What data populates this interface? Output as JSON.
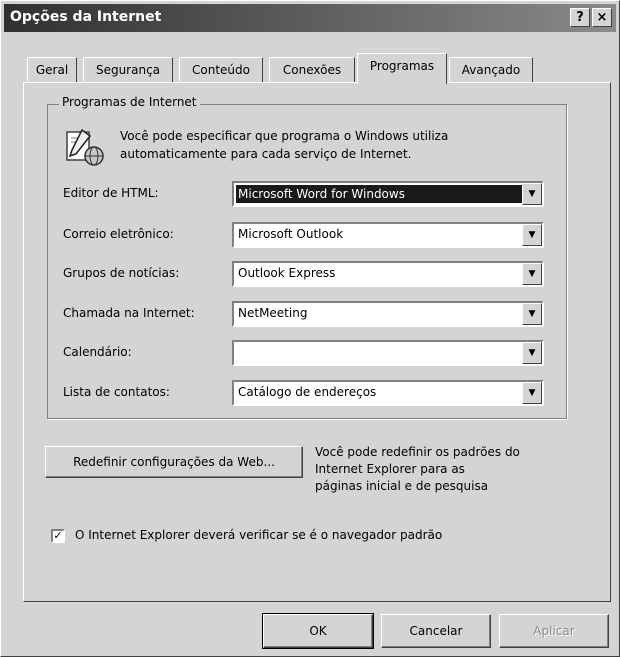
{
  "window": {
    "title": "Opções da Internet",
    "help_button": "?",
    "close_button": "×"
  },
  "tabs": [
    {
      "label": "Geral"
    },
    {
      "label": "Segurança"
    },
    {
      "label": "Conteúdo"
    },
    {
      "label": "Conexões"
    },
    {
      "label": "Programas",
      "active": true
    },
    {
      "label": "Avançado"
    }
  ],
  "programs_group": {
    "legend": "Programas de Internet",
    "description_line1": "Você pode especificar que programa o Windows utiliza",
    "description_line2": "automaticamente para cada serviço de Internet.",
    "rows": [
      {
        "label": "Editor de HTML:",
        "value": "Microsoft Word for Windows"
      },
      {
        "label": "Correio eletrônico:",
        "value": "Microsoft Outlook"
      },
      {
        "label": "Grupos de notícias:",
        "value": "Outlook Express"
      },
      {
        "label": "Chamada na Internet:",
        "value": "NetMeeting"
      },
      {
        "label": "Calendário:",
        "value": ""
      },
      {
        "label": "Lista de contatos:",
        "value": "Catálogo de endereços"
      }
    ]
  },
  "reset": {
    "button_label": "Redefinir configurações da Web...",
    "description_line1": "Você pode redefinir os padrões do",
    "description_line2": "Internet Explorer para as",
    "description_line3": "páginas inicial e de pesquisa"
  },
  "default_check": {
    "checked": true,
    "label": "O Internet Explorer deverá verificar se é o navegador padrão"
  },
  "footer": {
    "ok": "OK",
    "cancel": "Cancelar",
    "apply": "Aplicar"
  }
}
